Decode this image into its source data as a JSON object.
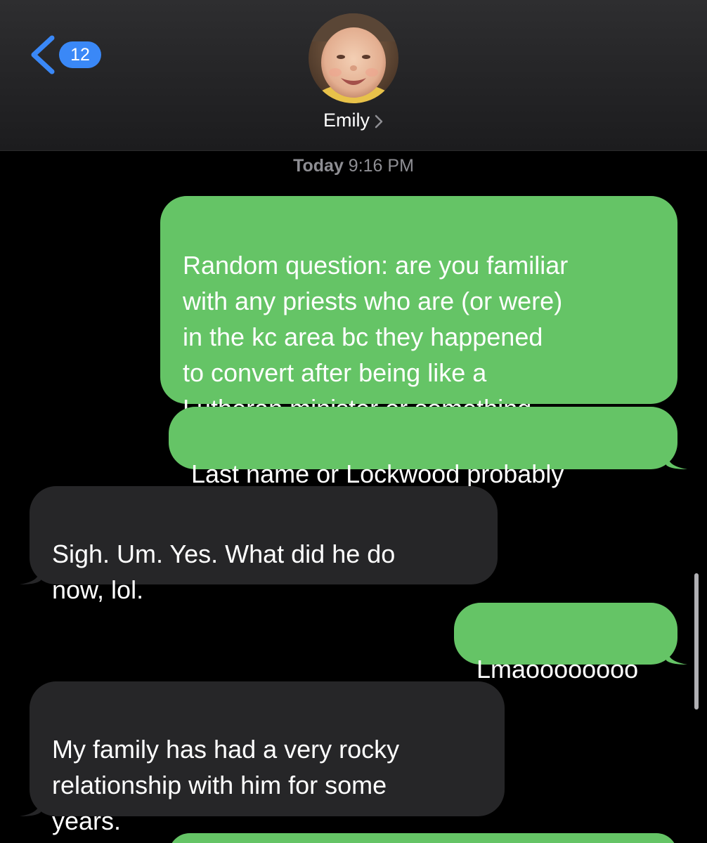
{
  "header": {
    "back_label": "",
    "unread_count": "12",
    "contact_name": "Emily"
  },
  "conversation": {
    "timestamp_day": "Today",
    "timestamp_time": "9:16 PM",
    "messages": [
      {
        "direction": "sent",
        "text": "Random question: are you familiar\nwith any priests who are (or were)\nin the kc area bc they happened\nto convert after being like a\nLutheran minister or something"
      },
      {
        "direction": "sent",
        "text": "Last name or Lockwood probably"
      },
      {
        "direction": "received",
        "text": "Sigh. Um. Yes. What did he do\nnow, lol."
      },
      {
        "direction": "sent",
        "text": "Lmaoooooooo"
      },
      {
        "direction": "received",
        "text": "My family has had a very rocky\nrelationship with him for some\nyears."
      }
    ]
  },
  "colors": {
    "sent_bubble": "#65c466",
    "received_bubble": "#262628",
    "badge": "#3a88f7",
    "accent_blue": "#3a88f7",
    "timestamp_gray": "#8e8e93"
  },
  "icons": {
    "back": "chevron-left-icon",
    "contact_details": "chevron-right-icon"
  }
}
